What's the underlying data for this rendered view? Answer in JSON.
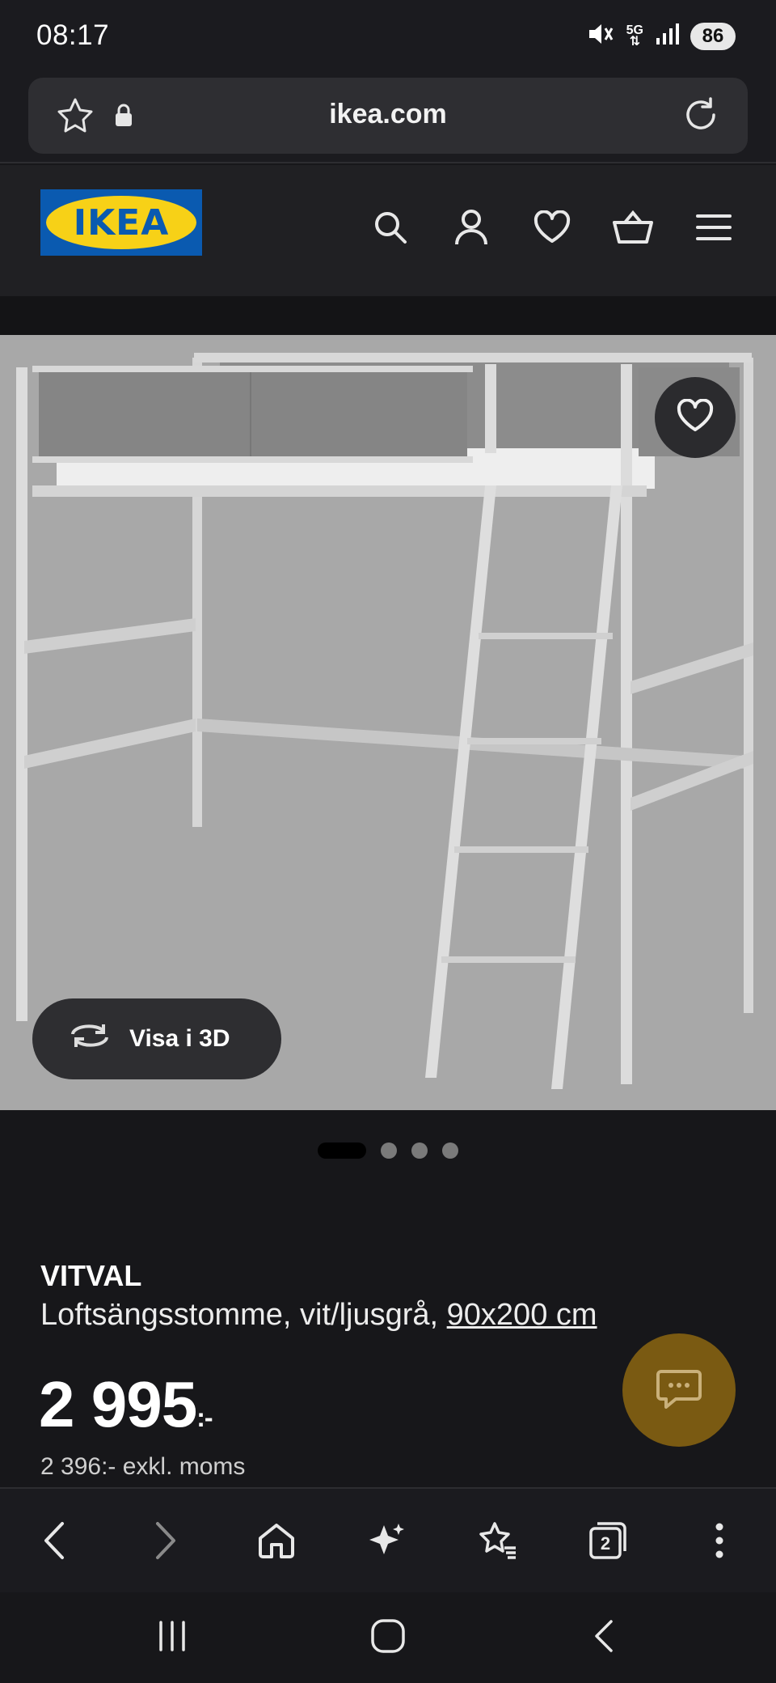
{
  "status_bar": {
    "time": "08:17",
    "network": "5G",
    "battery": "86",
    "icons": [
      "mute-vibrate-icon",
      "5g-icon",
      "signal-icon",
      "battery-icon"
    ]
  },
  "browser": {
    "url": "ikea.com",
    "icons": [
      "bookmark-star-icon",
      "lock-icon",
      "reload-icon"
    ]
  },
  "site_header": {
    "logo_text": "IKEA",
    "icons": [
      "search-icon",
      "account-icon",
      "heart-icon",
      "basket-icon",
      "menu-icon"
    ]
  },
  "gallery": {
    "view_3d_label": "Visa i 3D",
    "current_image": 1,
    "image_count": 4
  },
  "product": {
    "name": "VITVAL",
    "description": "Loftsängsstomme, vit/ljusgrå,",
    "size_link": "90x200 cm",
    "price": "2 995",
    "price_suffix": ":-",
    "price_ex_vat": "2 396:- exkl. moms"
  },
  "browser_bottom": {
    "tab_count": "2",
    "icons": [
      "back-icon",
      "forward-icon",
      "home-icon",
      "ai-sparkle-icon",
      "bookmarks-icon",
      "tabs-icon",
      "more-icon"
    ]
  },
  "colors": {
    "ikea_blue": "#0a5ab0",
    "ikea_yellow": "#f7d117",
    "chat_fab": "#7a5a12",
    "background": "#17171a"
  }
}
